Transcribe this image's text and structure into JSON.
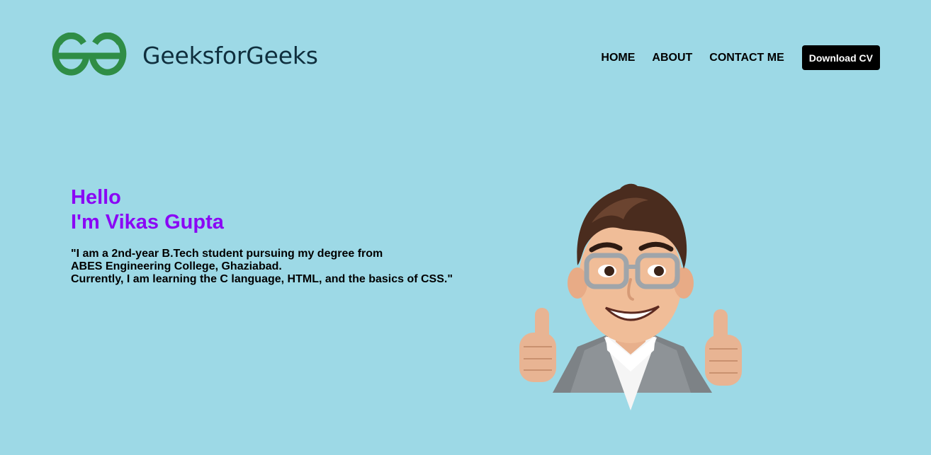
{
  "brand": {
    "name": "GeeksforGeeks",
    "logo_color": "#2f8d46",
    "text_color": "#0f2f3e"
  },
  "nav": {
    "items": [
      {
        "label": "HOME"
      },
      {
        "label": "ABOUT"
      },
      {
        "label": "CONTACT ME"
      }
    ],
    "cta_label": "Download CV"
  },
  "hero": {
    "greeting": "Hello",
    "name_line": "I'm Vikas Gupta",
    "description_lines": [
      "\"I am a 2nd-year B.Tech student pursuing my degree from",
      "ABES Engineering College, Ghaziabad.",
      "Currently, I am learning the C language, HTML, and the basics of CSS.\""
    ],
    "avatar_icon": "cartoon-thumbs-up-avatar"
  },
  "colors": {
    "background": "#9dd9e6",
    "accent": "#8a06f5",
    "button_bg": "#000000",
    "button_text": "#ffffff"
  }
}
